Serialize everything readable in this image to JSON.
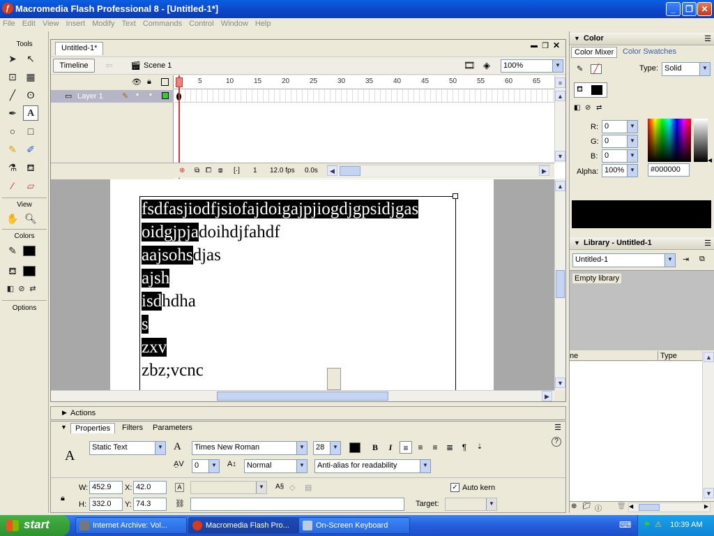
{
  "window": {
    "title": "Macromedia Flash Professional 8 - [Untitled-1*]"
  },
  "menu": [
    "File",
    "Edit",
    "View",
    "Insert",
    "Modify",
    "Text",
    "Commands",
    "Control",
    "Window",
    "Help"
  ],
  "tools": {
    "title": "Tools",
    "view_label": "View",
    "colors_label": "Colors",
    "options_label": "Options"
  },
  "document": {
    "tab": "Untitled-1*",
    "timeline_button": "Timeline",
    "scene": "Scene 1",
    "zoom": "100%",
    "layer_name": "Layer 1",
    "ruler": [
      "1",
      "5",
      "10",
      "15",
      "20",
      "25",
      "30",
      "35",
      "40",
      "45",
      "50",
      "55",
      "60",
      "65"
    ],
    "current_frame": "1",
    "fps": "12.0 fps",
    "time": "0.0s",
    "text_lines": [
      {
        "hl": "fsdfasjiodfjsiofajdoigajpjiogdjgpsidjgas",
        "rest": ""
      },
      {
        "hl": "oidgjpja",
        "rest": "doihdjfahdf"
      },
      {
        "hl": "aajsohs",
        "rest": "djas"
      },
      {
        "hl": "ajsh",
        "rest": ""
      },
      {
        "hl": "isd",
        "rest": "hdha"
      },
      {
        "hl": "s",
        "rest": ""
      },
      {
        "hl": "zxv",
        "rest": ""
      },
      {
        "hl": "",
        "rest": "zbz;vcnc"
      }
    ]
  },
  "actions_label": "Actions",
  "properties": {
    "tabs": [
      "Properties",
      "Filters",
      "Parameters"
    ],
    "text_type": "Static Text",
    "font": "Times New Roman",
    "size": "28",
    "spacing": "0",
    "position": "Normal",
    "antialias": "Anti-alias for readability",
    "auto_kern": "Auto kern",
    "w_label": "W:",
    "w": "452.9",
    "x_label": "X:",
    "x": "42.0",
    "h_label": "H:",
    "h": "332.0",
    "y_label": "Y:",
    "y": "74.3",
    "target_label": "Target:"
  },
  "color_panel": {
    "title": "Color",
    "tab_mixer": "Color Mixer",
    "tab_swatches": "Color Swatches",
    "type_label": "Type:",
    "type": "Solid",
    "r_label": "R:",
    "r": "0",
    "g_label": "G:",
    "g": "0",
    "b_label": "B:",
    "b": "0",
    "alpha_label": "Alpha:",
    "alpha": "100%",
    "hex": "#000000"
  },
  "library": {
    "title": "Library - Untitled-1",
    "doc": "Untitled-1",
    "empty": "Empty library",
    "col_name": "ne",
    "col_type": "Type"
  },
  "taskbar": {
    "start": "start",
    "items": [
      "Internet Archive: Vol...",
      "Macromedia Flash Pro...",
      "On-Screen Keyboard"
    ],
    "clock": "10:39 AM"
  },
  "colors": {
    "titlebar": "#0b46c9",
    "accent": "#245edb",
    "stage_bg": "#a8a8a8"
  }
}
